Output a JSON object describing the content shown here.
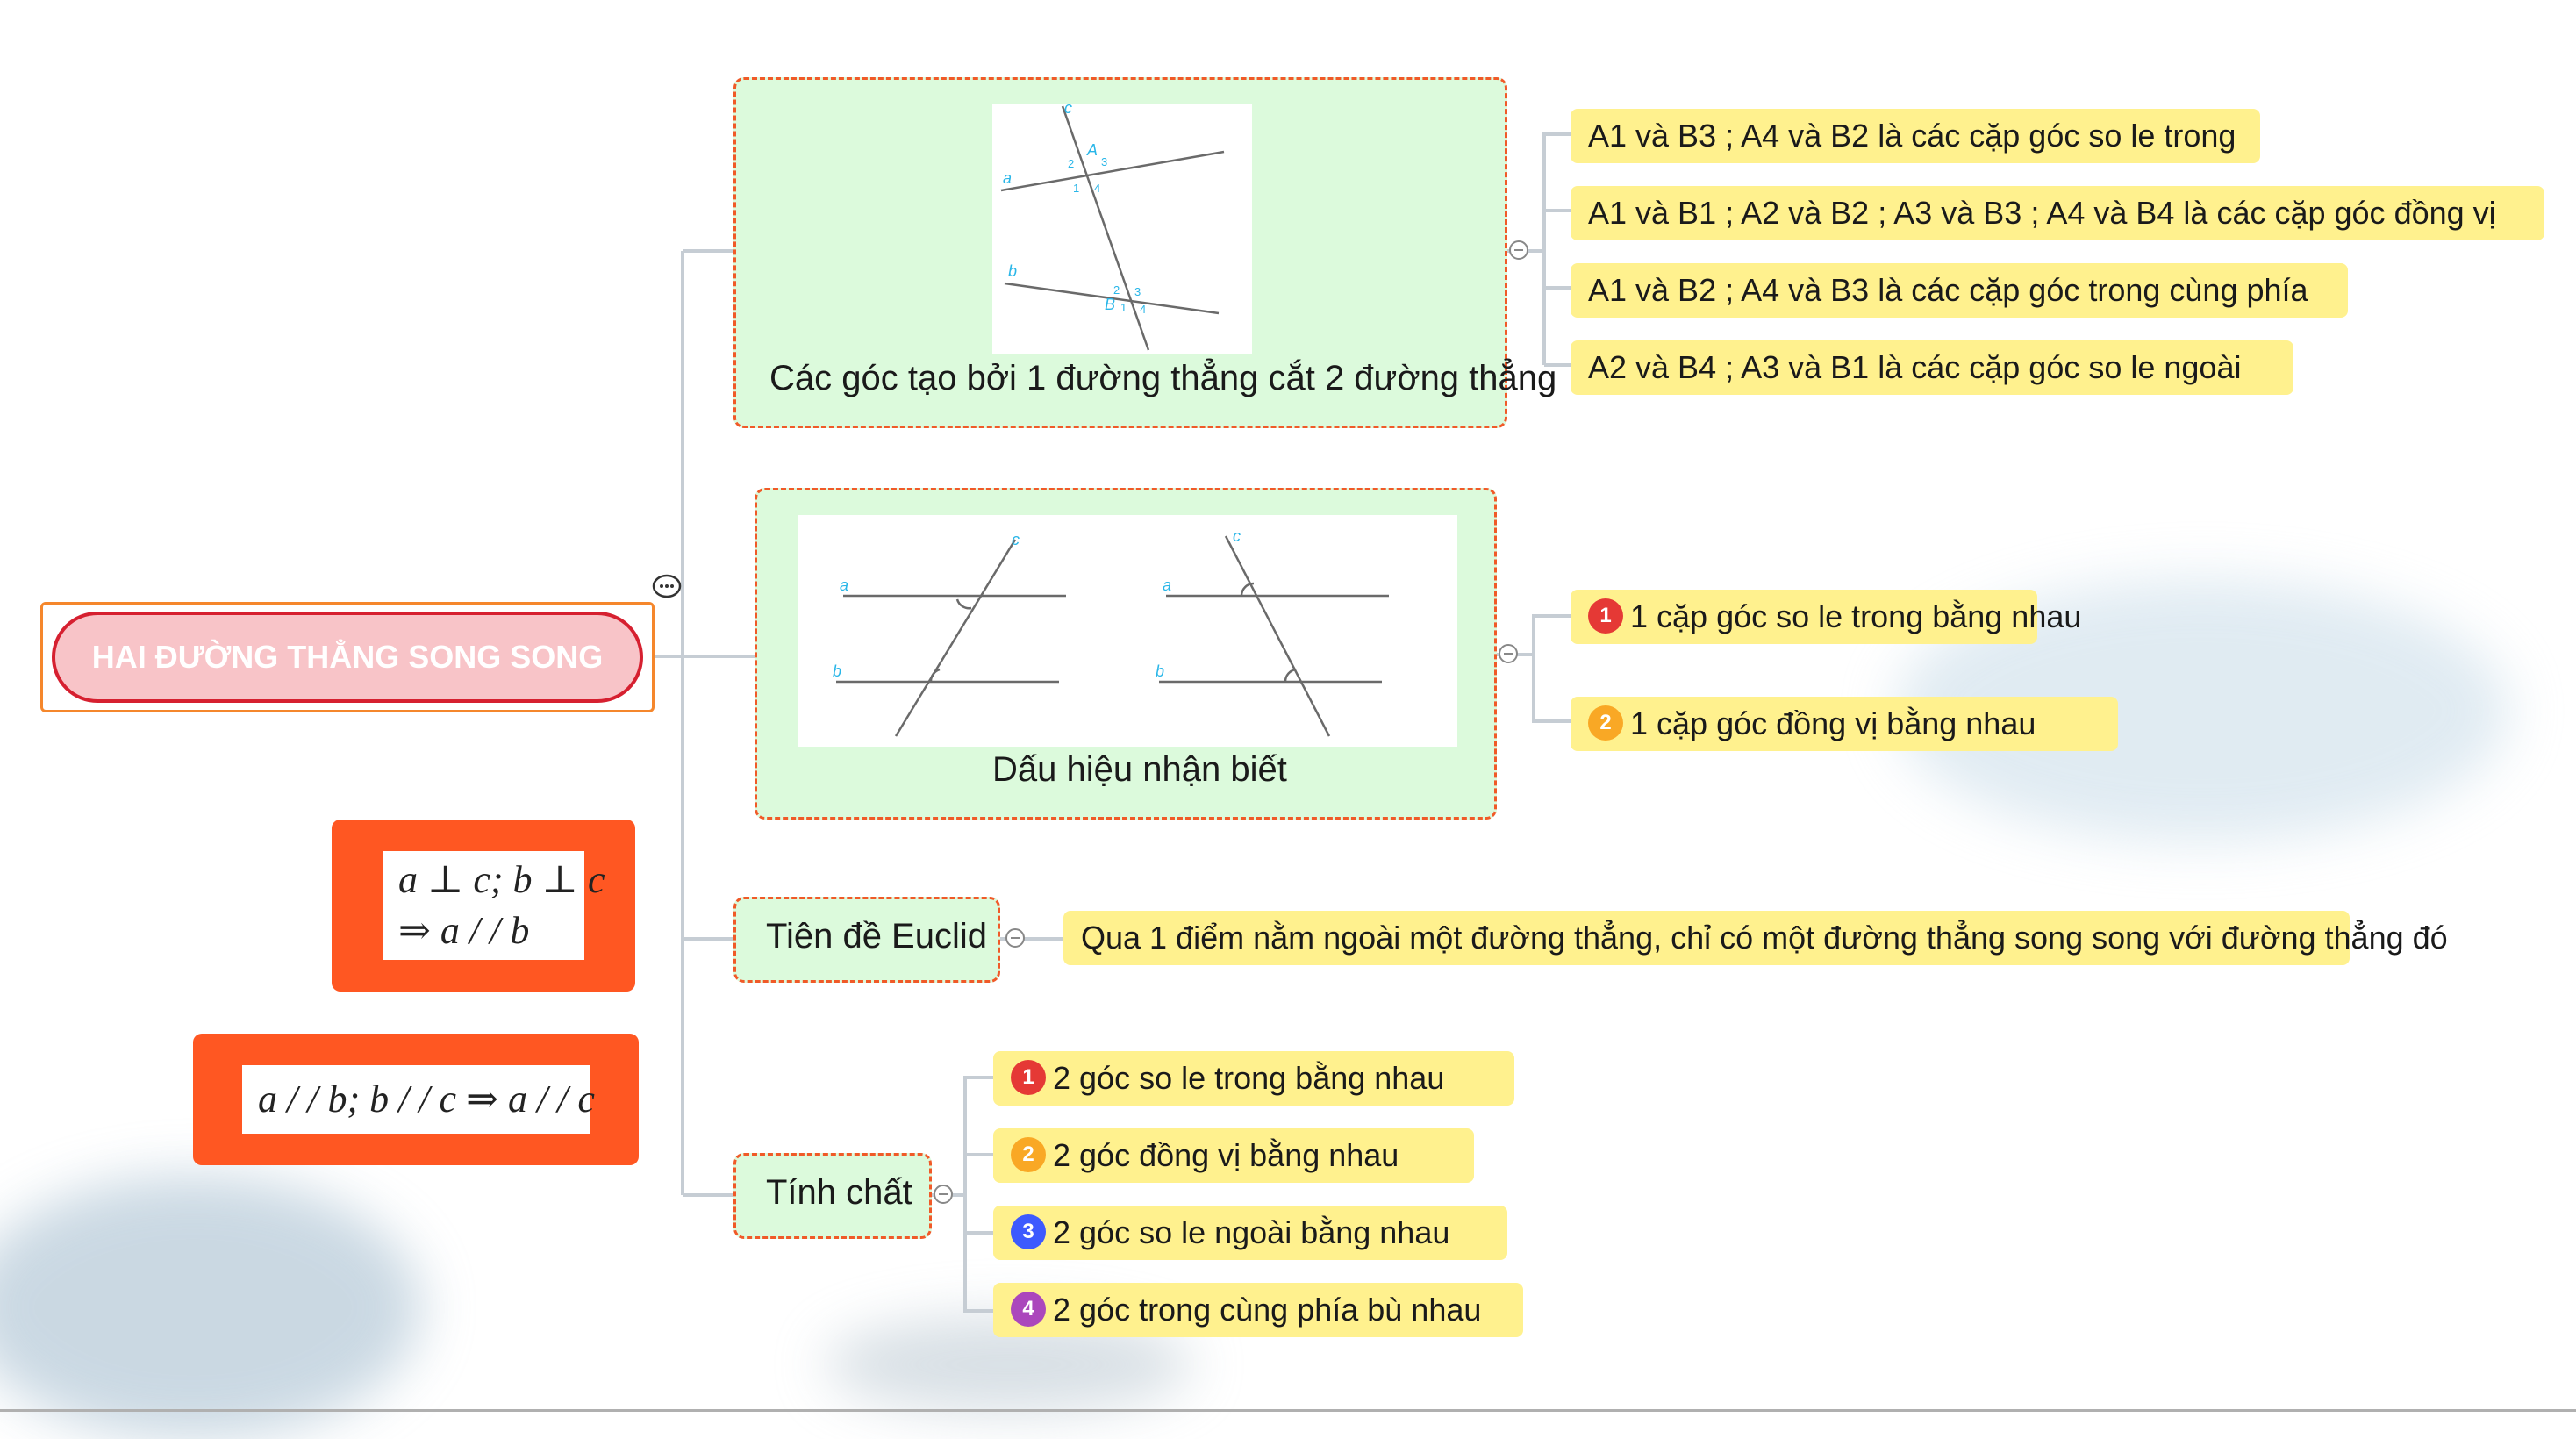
{
  "root": {
    "label": "HAI ĐƯỜNG THẲNG SONG SONG"
  },
  "formulas": [
    {
      "line1": "a ⊥ c; b ⊥ c",
      "line2": "⇒ a / / b"
    },
    {
      "line1": "a / / b; b / / c ⇒ a / / c"
    }
  ],
  "topics": [
    {
      "title": "Các góc tạo bởi 1 đường thẳng cắt 2 đường thẳng",
      "figure_labels": {
        "c": "c",
        "a": "a",
        "b": "b",
        "A": "A",
        "B": "B"
      },
      "children": [
        "A1 và B3 ; A4 và B2 là các cặp góc so le trong",
        "A1 và B1 ; A2 và B2 ; A3 và B3 ; A4 và B4 là các cặp góc đồng vị",
        "A1 và B2 ; A4 và B3 là các cặp góc trong cùng phía",
        "A2 và B4 ; A3 và B1 là các cặp góc so le ngoài"
      ]
    },
    {
      "title": "Dấu hiệu nhận biết",
      "children": [
        {
          "num": "1",
          "color": "#e53935",
          "text": "1 cặp góc so le trong bằng nhau"
        },
        {
          "num": "2",
          "color": "#f9a825",
          "text": "1 cặp góc đồng vị bằng nhau"
        }
      ]
    },
    {
      "title": "Tiên đề Euclid",
      "children": [
        "Qua 1 điểm nằm ngoài một đường thẳng, chỉ có một đường thẳng song song với đường thẳng đó"
      ]
    },
    {
      "title": "Tính chất",
      "children": [
        {
          "num": "1",
          "color": "#e53935",
          "text": "2 góc so le trong bằng nhau"
        },
        {
          "num": "2",
          "color": "#f9a825",
          "text": "2 góc đồng vị bằng nhau"
        },
        {
          "num": "3",
          "color": "#3d5afe",
          "text": "2 góc so le ngoài bằng nhau"
        },
        {
          "num": "4",
          "color": "#ab47bc",
          "text": "2 góc trong cùng phía bù nhau"
        }
      ]
    }
  ],
  "colors": {
    "node_fill": "#dcfadc",
    "node_border": "#f05a28",
    "leaf_fill": "#fff18e",
    "formula_fill": "#ff5722",
    "root_border": "#d62030"
  }
}
